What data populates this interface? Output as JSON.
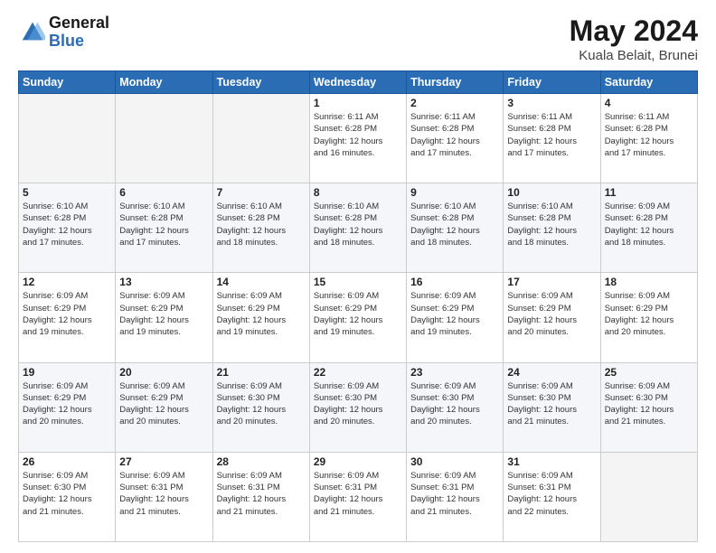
{
  "header": {
    "logo_general": "General",
    "logo_blue": "Blue",
    "title": "May 2024",
    "location": "Kuala Belait, Brunei"
  },
  "days_of_week": [
    "Sunday",
    "Monday",
    "Tuesday",
    "Wednesday",
    "Thursday",
    "Friday",
    "Saturday"
  ],
  "weeks": [
    [
      {
        "day": "",
        "info": ""
      },
      {
        "day": "",
        "info": ""
      },
      {
        "day": "",
        "info": ""
      },
      {
        "day": "1",
        "info": "Sunrise: 6:11 AM\nSunset: 6:28 PM\nDaylight: 12 hours\nand 16 minutes."
      },
      {
        "day": "2",
        "info": "Sunrise: 6:11 AM\nSunset: 6:28 PM\nDaylight: 12 hours\nand 17 minutes."
      },
      {
        "day": "3",
        "info": "Sunrise: 6:11 AM\nSunset: 6:28 PM\nDaylight: 12 hours\nand 17 minutes."
      },
      {
        "day": "4",
        "info": "Sunrise: 6:11 AM\nSunset: 6:28 PM\nDaylight: 12 hours\nand 17 minutes."
      }
    ],
    [
      {
        "day": "5",
        "info": "Sunrise: 6:10 AM\nSunset: 6:28 PM\nDaylight: 12 hours\nand 17 minutes."
      },
      {
        "day": "6",
        "info": "Sunrise: 6:10 AM\nSunset: 6:28 PM\nDaylight: 12 hours\nand 17 minutes."
      },
      {
        "day": "7",
        "info": "Sunrise: 6:10 AM\nSunset: 6:28 PM\nDaylight: 12 hours\nand 18 minutes."
      },
      {
        "day": "8",
        "info": "Sunrise: 6:10 AM\nSunset: 6:28 PM\nDaylight: 12 hours\nand 18 minutes."
      },
      {
        "day": "9",
        "info": "Sunrise: 6:10 AM\nSunset: 6:28 PM\nDaylight: 12 hours\nand 18 minutes."
      },
      {
        "day": "10",
        "info": "Sunrise: 6:10 AM\nSunset: 6:28 PM\nDaylight: 12 hours\nand 18 minutes."
      },
      {
        "day": "11",
        "info": "Sunrise: 6:09 AM\nSunset: 6:28 PM\nDaylight: 12 hours\nand 18 minutes."
      }
    ],
    [
      {
        "day": "12",
        "info": "Sunrise: 6:09 AM\nSunset: 6:29 PM\nDaylight: 12 hours\nand 19 minutes."
      },
      {
        "day": "13",
        "info": "Sunrise: 6:09 AM\nSunset: 6:29 PM\nDaylight: 12 hours\nand 19 minutes."
      },
      {
        "day": "14",
        "info": "Sunrise: 6:09 AM\nSunset: 6:29 PM\nDaylight: 12 hours\nand 19 minutes."
      },
      {
        "day": "15",
        "info": "Sunrise: 6:09 AM\nSunset: 6:29 PM\nDaylight: 12 hours\nand 19 minutes."
      },
      {
        "day": "16",
        "info": "Sunrise: 6:09 AM\nSunset: 6:29 PM\nDaylight: 12 hours\nand 19 minutes."
      },
      {
        "day": "17",
        "info": "Sunrise: 6:09 AM\nSunset: 6:29 PM\nDaylight: 12 hours\nand 20 minutes."
      },
      {
        "day": "18",
        "info": "Sunrise: 6:09 AM\nSunset: 6:29 PM\nDaylight: 12 hours\nand 20 minutes."
      }
    ],
    [
      {
        "day": "19",
        "info": "Sunrise: 6:09 AM\nSunset: 6:29 PM\nDaylight: 12 hours\nand 20 minutes."
      },
      {
        "day": "20",
        "info": "Sunrise: 6:09 AM\nSunset: 6:29 PM\nDaylight: 12 hours\nand 20 minutes."
      },
      {
        "day": "21",
        "info": "Sunrise: 6:09 AM\nSunset: 6:30 PM\nDaylight: 12 hours\nand 20 minutes."
      },
      {
        "day": "22",
        "info": "Sunrise: 6:09 AM\nSunset: 6:30 PM\nDaylight: 12 hours\nand 20 minutes."
      },
      {
        "day": "23",
        "info": "Sunrise: 6:09 AM\nSunset: 6:30 PM\nDaylight: 12 hours\nand 20 minutes."
      },
      {
        "day": "24",
        "info": "Sunrise: 6:09 AM\nSunset: 6:30 PM\nDaylight: 12 hours\nand 21 minutes."
      },
      {
        "day": "25",
        "info": "Sunrise: 6:09 AM\nSunset: 6:30 PM\nDaylight: 12 hours\nand 21 minutes."
      }
    ],
    [
      {
        "day": "26",
        "info": "Sunrise: 6:09 AM\nSunset: 6:30 PM\nDaylight: 12 hours\nand 21 minutes."
      },
      {
        "day": "27",
        "info": "Sunrise: 6:09 AM\nSunset: 6:31 PM\nDaylight: 12 hours\nand 21 minutes."
      },
      {
        "day": "28",
        "info": "Sunrise: 6:09 AM\nSunset: 6:31 PM\nDaylight: 12 hours\nand 21 minutes."
      },
      {
        "day": "29",
        "info": "Sunrise: 6:09 AM\nSunset: 6:31 PM\nDaylight: 12 hours\nand 21 minutes."
      },
      {
        "day": "30",
        "info": "Sunrise: 6:09 AM\nSunset: 6:31 PM\nDaylight: 12 hours\nand 21 minutes."
      },
      {
        "day": "31",
        "info": "Sunrise: 6:09 AM\nSunset: 6:31 PM\nDaylight: 12 hours\nand 22 minutes."
      },
      {
        "day": "",
        "info": ""
      }
    ]
  ]
}
